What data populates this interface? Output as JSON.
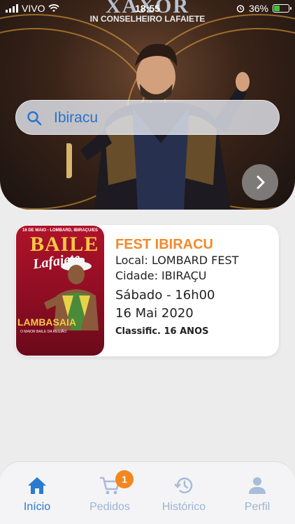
{
  "status_bar": {
    "carrier": "VIVO",
    "time": "18:55",
    "battery": "36%",
    "battery_level": 0.36
  },
  "hero": {
    "title": "XAXOR",
    "subtitle": "IN CONSELHEIRO LAFAIETE"
  },
  "search": {
    "value": "Ibiracu",
    "placeholder": ""
  },
  "event": {
    "title": "FEST IBIRACU",
    "local": "Local: LOMBARD FEST",
    "cidade": "Cidade: IBIRAÇU",
    "day_time": "Sábado - 16h00",
    "date": "16 Mai 2020",
    "classification": "Classific. 16 ANOS",
    "poster": {
      "top_text": "16 DE MAIO - LOMBARD, IBIRAÇU/ES",
      "title": "BAILE",
      "subtitle": "Lafaiete",
      "artist": "LAMBASAIA",
      "small_text": "O MAIOR BAILE DA REGIÃO"
    }
  },
  "tabs": [
    {
      "label": "Início",
      "icon": "home-icon"
    },
    {
      "label": "Pedidos",
      "icon": "cart-icon",
      "badge": "1"
    },
    {
      "label": "Histórico",
      "icon": "history-icon"
    },
    {
      "label": "Perfil",
      "icon": "person-icon"
    }
  ],
  "colors": {
    "accent": "#2a7ad0",
    "event_title": "#f28a2b",
    "badge": "#f4861f"
  }
}
